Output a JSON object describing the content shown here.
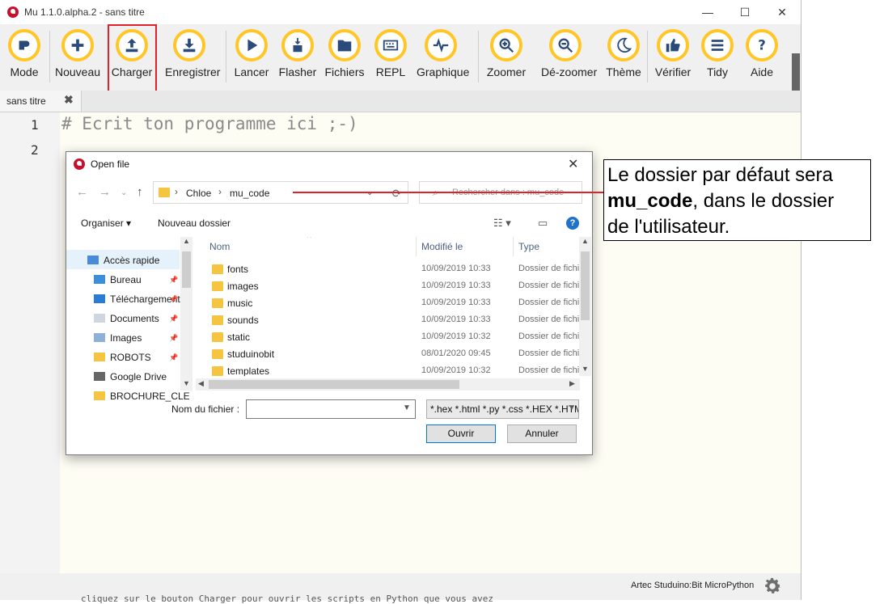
{
  "window": {
    "title": "Mu 1.1.0.alpha.2 - sans titre",
    "controls": {
      "minimize": "—",
      "maximize": "☐",
      "close": "✕"
    }
  },
  "toolbar": {
    "buttons": [
      {
        "label": "Mode",
        "icon": "mode-icon"
      },
      {
        "label": "Nouveau",
        "icon": "plus-icon"
      },
      {
        "label": "Charger",
        "icon": "upload-icon"
      },
      {
        "label": "Enregistrer",
        "icon": "download-icon"
      },
      {
        "label": "Lancer",
        "icon": "play-icon"
      },
      {
        "label": "Flasher",
        "icon": "flash-icon"
      },
      {
        "label": "Fichiers",
        "icon": "files-icon"
      },
      {
        "label": "REPL",
        "icon": "keyboard-icon"
      },
      {
        "label": "Graphique",
        "icon": "pulse-icon"
      },
      {
        "label": "Zoomer",
        "icon": "zoom-in-icon"
      },
      {
        "label": "Dé-zoomer",
        "icon": "zoom-out-icon"
      },
      {
        "label": "Thème",
        "icon": "moon-icon"
      },
      {
        "label": "Vérifier",
        "icon": "thumbs-up-icon"
      },
      {
        "label": "Tidy",
        "icon": "lines-icon"
      },
      {
        "label": "Aide",
        "icon": "question-icon"
      }
    ],
    "accent": "#ffc626",
    "highlight_color": "#e0212a"
  },
  "tab": {
    "label": "sans titre",
    "close": "✖"
  },
  "editor": {
    "line_numbers": [
      "1",
      "2"
    ],
    "code": "# Ecrit ton programme ici ;-)"
  },
  "status": {
    "mode": "Artec Studuino:Bit MicroPython"
  },
  "bottom_ghost_text": "cliquez sur le bouton Charger pour ouvrir les scripts en Python que vous avez",
  "dialog": {
    "title": "Open file",
    "close": "✕",
    "breadcrumb": [
      "Chloe",
      "mu_code"
    ],
    "search_placeholder": "Rechercher dans : mu_code",
    "organize": "Organiser ▾",
    "new_folder": "Nouveau dossier",
    "nav_items": [
      {
        "label": "Accès rapide",
        "icon": "star-icon"
      },
      {
        "label": "Bureau",
        "icon": "desktop-icon"
      },
      {
        "label": "Téléchargements",
        "icon": "download-arrow-icon"
      },
      {
        "label": "Documents",
        "icon": "document-icon"
      },
      {
        "label": "Images",
        "icon": "picture-icon"
      },
      {
        "label": "ROBOTS",
        "icon": "folder-icon"
      },
      {
        "label": "Google Drive",
        "icon": "drive-icon"
      },
      {
        "label": "BROCHURE_CLE",
        "icon": "folder-icon"
      }
    ],
    "columns": {
      "name": "Nom",
      "modified": "Modifié le",
      "type": "Type"
    },
    "files": [
      {
        "name": "fonts",
        "date": "10/09/2019 10:33",
        "type": "Dossier de fichiers"
      },
      {
        "name": "images",
        "date": "10/09/2019 10:33",
        "type": "Dossier de fichiers"
      },
      {
        "name": "music",
        "date": "10/09/2019 10:33",
        "type": "Dossier de fichiers"
      },
      {
        "name": "sounds",
        "date": "10/09/2019 10:33",
        "type": "Dossier de fichiers"
      },
      {
        "name": "static",
        "date": "10/09/2019 10:32",
        "type": "Dossier de fichiers"
      },
      {
        "name": "studuinobit",
        "date": "08/01/2020 09:45",
        "type": "Dossier de fichiers"
      },
      {
        "name": "templates",
        "date": "10/09/2019 10:32",
        "type": "Dossier de fichiers"
      }
    ],
    "filename_label": "Nom du fichier :",
    "filename_value": "",
    "filter": "*.hex *.html *.py *.css *.HEX *.HTML",
    "ok": "Ouvrir",
    "cancel": "Annuler"
  },
  "callout": {
    "line1": "Le dossier par défaut sera",
    "bold": "mu_code",
    "line2_rest": ", dans le dossier",
    "line3": "de l'utilisateur."
  }
}
